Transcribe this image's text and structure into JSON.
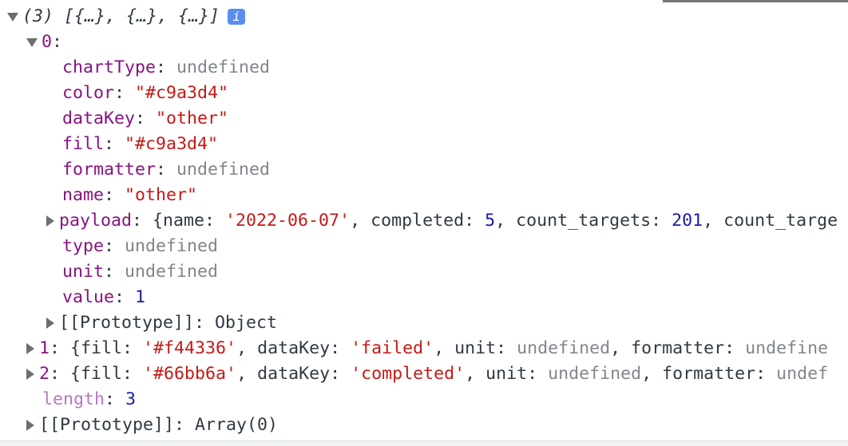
{
  "colors": {
    "key": "#881280",
    "string": "#c41a16",
    "undefined": "#80868b",
    "number": "#1c00cf",
    "badge": "#5b8def"
  },
  "header": {
    "summary": "(3) [{…}, {…}, {…}]",
    "info_badge": "i"
  },
  "item0": {
    "index": "0",
    "props": [
      {
        "key": "chartType",
        "value": "undefined",
        "kind": "undef"
      },
      {
        "key": "color",
        "value": "\"#c9a3d4\"",
        "kind": "str"
      },
      {
        "key": "dataKey",
        "value": "\"other\"",
        "kind": "str"
      },
      {
        "key": "fill",
        "value": "\"#c9a3d4\"",
        "kind": "str"
      },
      {
        "key": "formatter",
        "value": "undefined",
        "kind": "undef"
      },
      {
        "key": "name",
        "value": "\"other\"",
        "kind": "str"
      }
    ],
    "payload": {
      "key": "payload",
      "open": "{name: ",
      "name": "'2022-06-07'",
      "c1": ", completed: ",
      "completed": "5",
      "c2": ", count_targets: ",
      "count_targets": "201",
      "c3": ", count_targe"
    },
    "props2": [
      {
        "key": "type",
        "value": "undefined",
        "kind": "undef"
      },
      {
        "key": "unit",
        "value": "undefined",
        "kind": "undef"
      },
      {
        "key": "value",
        "value": "1",
        "kind": "num"
      }
    ],
    "prototype": "[[Prototype]]: Object"
  },
  "item1": {
    "index": "1",
    "open": "{fill: ",
    "fill": "'#f44336'",
    "c1": ", dataKey: ",
    "dataKey": "'failed'",
    "c2": ", unit: ",
    "unit": "undefined",
    "c3": ", formatter: ",
    "formatter": "undefine"
  },
  "item2": {
    "index": "2",
    "open": "{fill: ",
    "fill": "'#66bb6a'",
    "c1": ", dataKey: ",
    "dataKey": "'completed'",
    "c2": ", unit: ",
    "unit": "undefined",
    "c3": ", formatter: ",
    "formatter": "undef"
  },
  "length": {
    "key": "length",
    "value": "3"
  },
  "array_prototype": "[[Prototype]]: Array(0)"
}
